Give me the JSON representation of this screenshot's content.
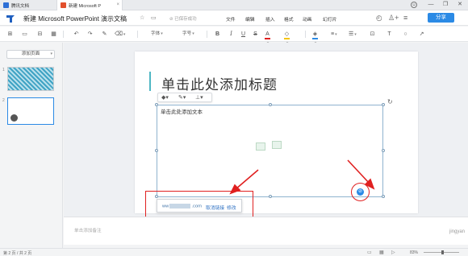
{
  "browser": {
    "tabs": [
      {
        "label": "腾讯文档"
      },
      {
        "label": "新建 Microsoft P"
      }
    ],
    "tab_close": "×",
    "window_controls": [
      "☺",
      "—",
      "❐",
      "✕"
    ]
  },
  "titlebar": {
    "doc_title": "新建 Microsoft PowerPoint 演示文稿",
    "sync_text": "⊘ 已保存成功",
    "menu": [
      "文件",
      "编辑",
      "插入",
      "格式",
      "动画",
      "幻灯片"
    ],
    "share_label": "分享"
  },
  "toolbar": {
    "font_label": "字体",
    "size_label": "字号"
  },
  "leftpane": {
    "add_page_label": "添加页面",
    "slide_numbers": [
      "1",
      "2"
    ]
  },
  "slide": {
    "title_placeholder": "单击此处添加标题",
    "body_placeholder": "单击此处添加文本"
  },
  "link_popup": {
    "url_prefix": "ww",
    "url_suffix": ".com",
    "cancel_link": "取消链接",
    "edit": "修改"
  },
  "notes": {
    "placeholder": "单击添加备注"
  },
  "statusbar": {
    "page_info": "第 2 页 / 共 2 页",
    "zoom": "83%"
  },
  "colors": {
    "accent": "#2b8ae5",
    "annotation": "#e02020"
  }
}
